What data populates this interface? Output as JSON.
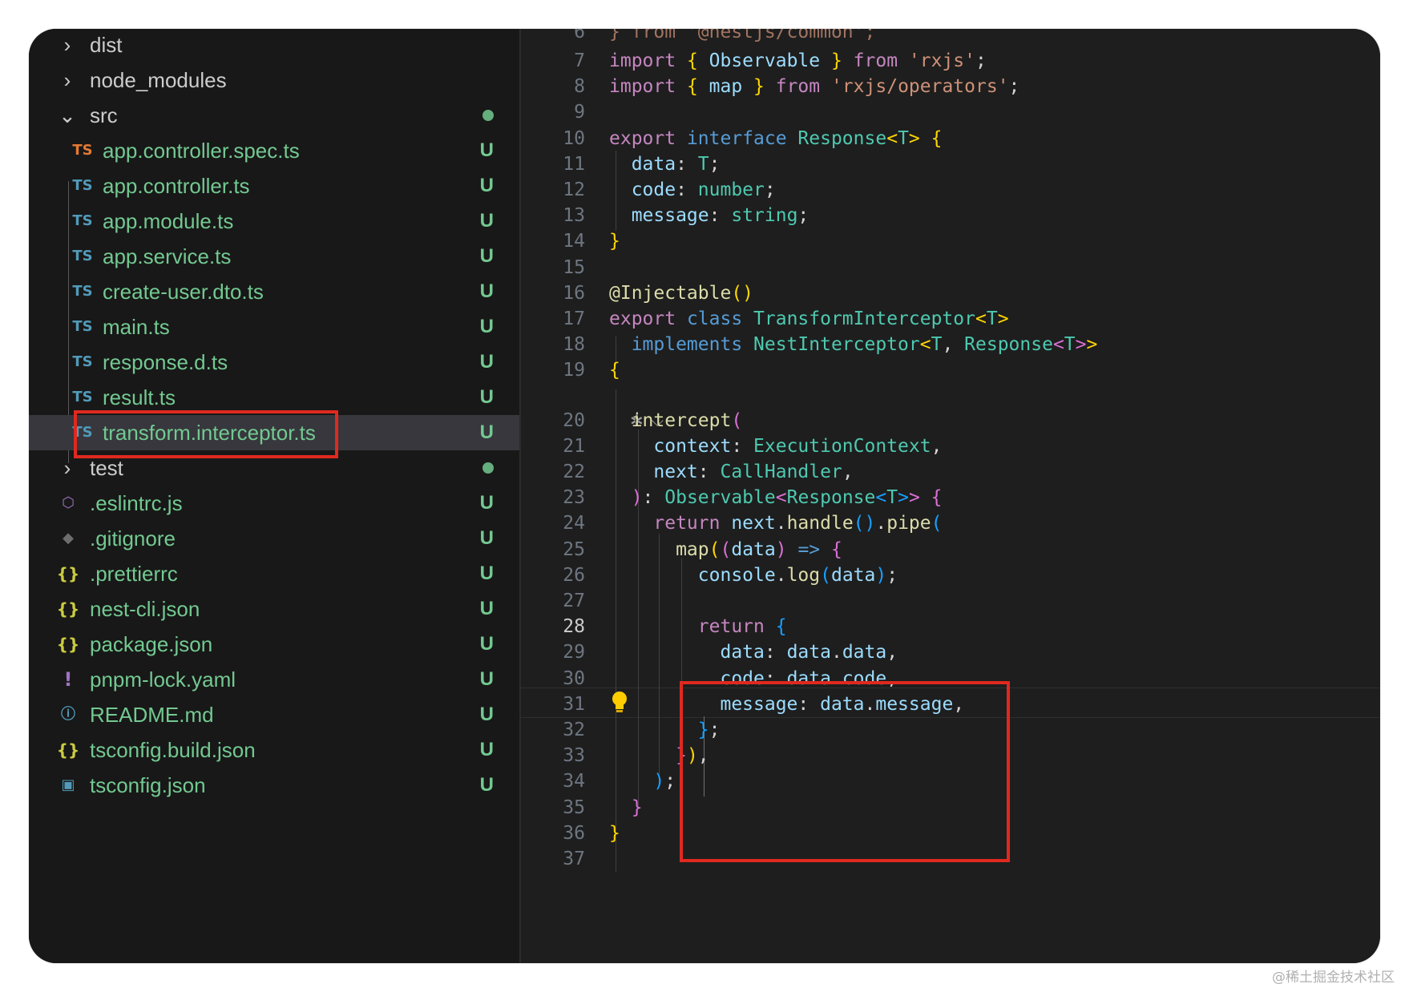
{
  "explorer": {
    "items": [
      {
        "label": "dist",
        "kind": "folder",
        "expanded": false,
        "depth": 0
      },
      {
        "label": "node_modules",
        "kind": "folder",
        "expanded": false,
        "depth": 0
      },
      {
        "label": "src",
        "kind": "folder",
        "expanded": true,
        "depth": 0,
        "status_dot": true
      },
      {
        "label": "app.controller.spec.ts",
        "icon": "TS",
        "kind": "file",
        "depth": 1,
        "status": "U"
      },
      {
        "label": "app.controller.ts",
        "icon": "TS",
        "kind": "file",
        "depth": 1,
        "status": "U"
      },
      {
        "label": "app.module.ts",
        "icon": "TS",
        "kind": "file",
        "depth": 1,
        "status": "U"
      },
      {
        "label": "app.service.ts",
        "icon": "TS",
        "kind": "file",
        "depth": 1,
        "status": "U"
      },
      {
        "label": "create-user.dto.ts",
        "icon": "TS",
        "kind": "file",
        "depth": 1,
        "status": "U"
      },
      {
        "label": "main.ts",
        "icon": "TS",
        "kind": "file",
        "depth": 1,
        "status": "U"
      },
      {
        "label": "response.d.ts",
        "icon": "TS",
        "kind": "file",
        "depth": 1,
        "status": "U"
      },
      {
        "label": "result.ts",
        "icon": "TS",
        "kind": "file",
        "depth": 1,
        "status": "U"
      },
      {
        "label": "transform.interceptor.ts",
        "icon": "TS",
        "kind": "file",
        "depth": 1,
        "status": "U",
        "selected": true
      },
      {
        "label": "test",
        "kind": "folder",
        "expanded": false,
        "depth": 0,
        "status_dot": true
      },
      {
        "label": ".eslintrc.js",
        "icon": "eslint-icon",
        "kind": "file",
        "depth": 0,
        "status": "U"
      },
      {
        "label": ".gitignore",
        "icon": "git-icon",
        "kind": "file",
        "depth": 0,
        "status": "U"
      },
      {
        "label": ".prettierrc",
        "icon": "{}",
        "kind": "file",
        "depth": 0,
        "status": "U"
      },
      {
        "label": "nest-cli.json",
        "icon": "{}",
        "kind": "file",
        "depth": 0,
        "status": "U"
      },
      {
        "label": "package.json",
        "icon": "{}",
        "kind": "file",
        "depth": 0,
        "status": "U"
      },
      {
        "label": "pnpm-lock.yaml",
        "icon": "!",
        "kind": "file",
        "depth": 0,
        "status": "U"
      },
      {
        "label": "README.md",
        "icon": "info-icon",
        "kind": "file",
        "depth": 0,
        "status": "U"
      },
      {
        "label": "tsconfig.build.json",
        "icon": "{}",
        "kind": "file",
        "depth": 0,
        "status": "U"
      },
      {
        "label": "tsconfig.json",
        "icon": "ts-config-icon",
        "kind": "file",
        "depth": 0,
        "status": "U"
      }
    ]
  },
  "editor": {
    "active_line": 28,
    "partial_top_line": "} from '@nestjs/common';",
    "lines": [
      {
        "n": 7,
        "tokens": [
          [
            "import ",
            "ctl"
          ],
          [
            "{ ",
            "p1"
          ],
          [
            "Observable ",
            "var"
          ],
          [
            "} ",
            "p1"
          ],
          [
            "from ",
            "ctl"
          ],
          [
            "'rxjs'",
            "str"
          ],
          [
            ";",
            ""
          ]
        ]
      },
      {
        "n": 8,
        "tokens": [
          [
            "import ",
            "ctl"
          ],
          [
            "{ ",
            "p1"
          ],
          [
            "map ",
            "var"
          ],
          [
            "} ",
            "p1"
          ],
          [
            "from ",
            "ctl"
          ],
          [
            "'rxjs/operators'",
            "str"
          ],
          [
            ";",
            ""
          ]
        ]
      },
      {
        "n": 9,
        "tokens": []
      },
      {
        "n": 10,
        "tokens": [
          [
            "export ",
            "ctl"
          ],
          [
            "interface ",
            "kw"
          ],
          [
            "Response",
            "ty"
          ],
          [
            "<",
            "p1"
          ],
          [
            "T",
            "ty"
          ],
          [
            "> ",
            "p1"
          ],
          [
            "{",
            "p1"
          ]
        ]
      },
      {
        "n": 11,
        "tokens": [
          [
            "  data",
            "var"
          ],
          [
            ": ",
            ""
          ],
          [
            "T",
            "ty"
          ],
          [
            ";",
            ""
          ]
        ]
      },
      {
        "n": 12,
        "tokens": [
          [
            "  code",
            "var"
          ],
          [
            ": ",
            ""
          ],
          [
            "number",
            "ty"
          ],
          [
            ";",
            ""
          ]
        ]
      },
      {
        "n": 13,
        "tokens": [
          [
            "  message",
            "var"
          ],
          [
            ": ",
            ""
          ],
          [
            "string",
            "ty"
          ],
          [
            ";",
            ""
          ]
        ]
      },
      {
        "n": 14,
        "tokens": [
          [
            "}",
            "p1"
          ]
        ]
      },
      {
        "n": 15,
        "tokens": []
      },
      {
        "n": 16,
        "tokens": [
          [
            "@Injectable",
            "fn"
          ],
          [
            "()",
            "p1"
          ]
        ]
      },
      {
        "n": 17,
        "tokens": [
          [
            "export ",
            "ctl"
          ],
          [
            "class ",
            "kw"
          ],
          [
            "TransformInterceptor",
            "ty"
          ],
          [
            "<",
            "p1"
          ],
          [
            "T",
            "ty"
          ],
          [
            ">",
            "p1"
          ]
        ]
      },
      {
        "n": 18,
        "tokens": [
          [
            "  implements ",
            "kw"
          ],
          [
            "NestInterceptor",
            "ty"
          ],
          [
            "<",
            "p1"
          ],
          [
            "T",
            "ty"
          ],
          [
            ", ",
            ""
          ],
          [
            "Response",
            "ty"
          ],
          [
            "<",
            "p2"
          ],
          [
            "T",
            "ty"
          ],
          [
            ">",
            "p2"
          ],
          [
            ">",
            "p1"
          ]
        ]
      },
      {
        "n": 19,
        "tokens": [
          [
            "{",
            "p1"
          ]
        ]
      },
      {
        "n": 20,
        "tokens": [
          [
            "  intercept",
            "fn"
          ],
          [
            "(",
            "p2"
          ]
        ]
      },
      {
        "n": 21,
        "tokens": [
          [
            "    context",
            "var"
          ],
          [
            ": ",
            ""
          ],
          [
            "ExecutionContext",
            "ty"
          ],
          [
            ",",
            ""
          ]
        ]
      },
      {
        "n": 22,
        "tokens": [
          [
            "    next",
            "var"
          ],
          [
            ": ",
            ""
          ],
          [
            "CallHandler",
            "ty"
          ],
          [
            ",",
            ""
          ]
        ]
      },
      {
        "n": 23,
        "tokens": [
          [
            "  )",
            "p2"
          ],
          [
            ": ",
            ""
          ],
          [
            "Observable",
            "ty"
          ],
          [
            "<",
            "p2"
          ],
          [
            "Response",
            "ty"
          ],
          [
            "<",
            "p3"
          ],
          [
            "T",
            "ty"
          ],
          [
            ">",
            "p3"
          ],
          [
            ">",
            "p2"
          ],
          [
            " ",
            ""
          ],
          [
            "{",
            "p2"
          ]
        ]
      },
      {
        "n": 24,
        "tokens": [
          [
            "    return ",
            "ctl"
          ],
          [
            "next",
            "var"
          ],
          [
            ".",
            ""
          ],
          [
            "handle",
            "fn"
          ],
          [
            "()",
            "p3"
          ],
          [
            ".",
            ""
          ],
          [
            "pipe",
            "fn"
          ],
          [
            "(",
            "p3"
          ]
        ]
      },
      {
        "n": 25,
        "tokens": [
          [
            "      map",
            "fn"
          ],
          [
            "(",
            "p1"
          ],
          [
            "(",
            "p2"
          ],
          [
            "data",
            "var"
          ],
          [
            ") ",
            "p2"
          ],
          [
            "=> ",
            "kw"
          ],
          [
            "{",
            "p2"
          ]
        ]
      },
      {
        "n": 26,
        "tokens": [
          [
            "        console",
            "var"
          ],
          [
            ".",
            ""
          ],
          [
            "log",
            "fn"
          ],
          [
            "(",
            "p3"
          ],
          [
            "data",
            "var"
          ],
          [
            ")",
            "p3"
          ],
          [
            ";",
            ""
          ]
        ]
      },
      {
        "n": 27,
        "tokens": []
      },
      {
        "n": 28,
        "tokens": [
          [
            "        return ",
            "ctl"
          ],
          [
            "{",
            "p3"
          ]
        ]
      },
      {
        "n": 29,
        "tokens": [
          [
            "          data",
            "var"
          ],
          [
            ": ",
            ""
          ],
          [
            "data",
            "var"
          ],
          [
            ".",
            ""
          ],
          [
            "data",
            "var"
          ],
          [
            ",",
            ""
          ]
        ]
      },
      {
        "n": 30,
        "tokens": [
          [
            "          code",
            "var"
          ],
          [
            ": ",
            ""
          ],
          [
            "data",
            "var"
          ],
          [
            ".",
            ""
          ],
          [
            "code",
            "var"
          ],
          [
            ",",
            ""
          ]
        ]
      },
      {
        "n": 31,
        "tokens": [
          [
            "          message",
            "var"
          ],
          [
            ": ",
            ""
          ],
          [
            "data",
            "var"
          ],
          [
            ".",
            ""
          ],
          [
            "message",
            "var"
          ],
          [
            ",",
            ""
          ]
        ]
      },
      {
        "n": 32,
        "tokens": [
          [
            "        }",
            "p3"
          ],
          [
            ";",
            ""
          ]
        ]
      },
      {
        "n": 33,
        "tokens": [
          [
            "      }",
            "p2"
          ],
          [
            ")",
            "p1"
          ],
          [
            ",",
            ""
          ]
        ]
      },
      {
        "n": 34,
        "tokens": [
          [
            "    )",
            "p3"
          ],
          [
            ";",
            ""
          ]
        ]
      },
      {
        "n": 35,
        "tokens": [
          [
            "  }",
            "p2"
          ]
        ]
      },
      {
        "n": 36,
        "tokens": [
          [
            "}",
            "p1"
          ]
        ]
      },
      {
        "n": 37,
        "tokens": []
      }
    ]
  },
  "colors": {
    "background": "#1e1e1e",
    "sidebar": "#181818",
    "selection": "#37373d",
    "untracked": "#73c991",
    "ts_icon": "#519aba",
    "spec_icon": "#e37933",
    "json_icon": "#cbcb41",
    "yaml_icon": "#a074c4",
    "highlight_box": "#e0291f"
  },
  "watermark": "@稀土掘金技术社区"
}
